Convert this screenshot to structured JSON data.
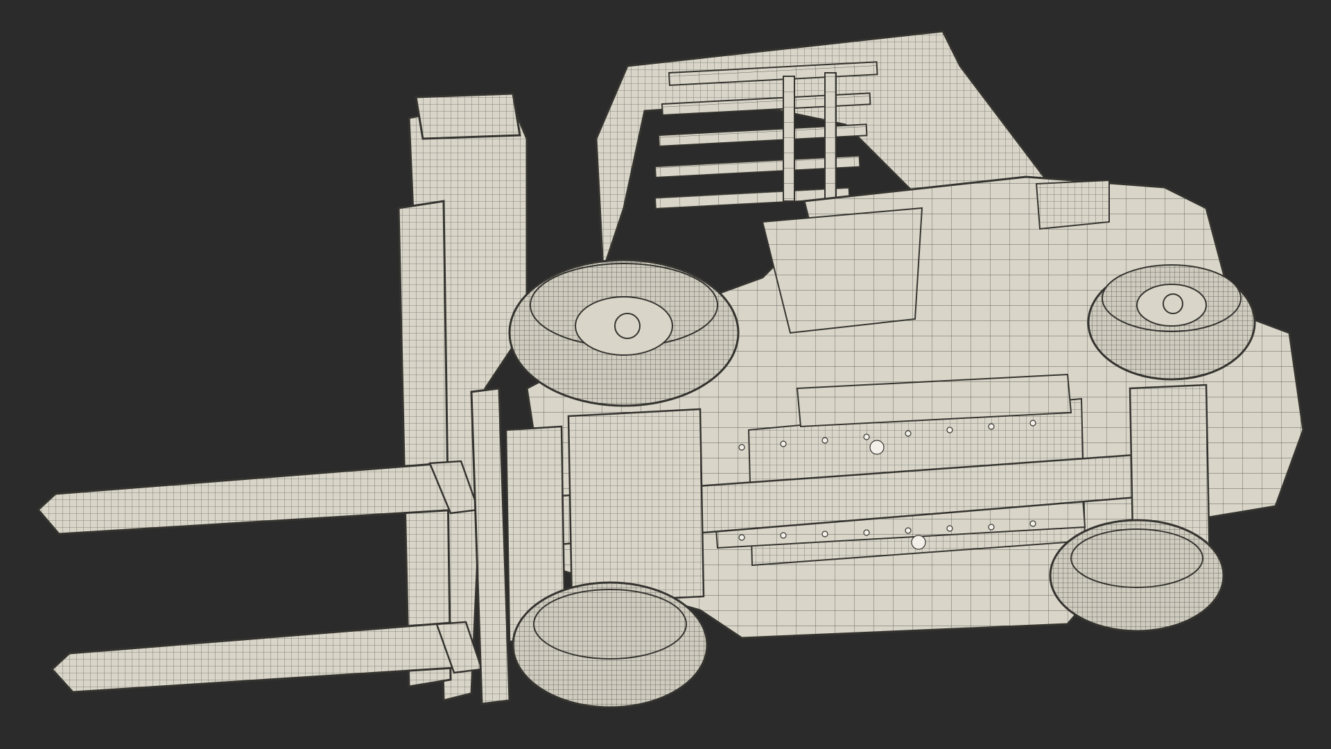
{
  "scene": {
    "background_color": "#2b2b2b",
    "model_fill_color": "#d9d6c9",
    "wire_color": "#55544f",
    "outline_color": "#34332f",
    "subject": "forklift-wireframe-render"
  }
}
